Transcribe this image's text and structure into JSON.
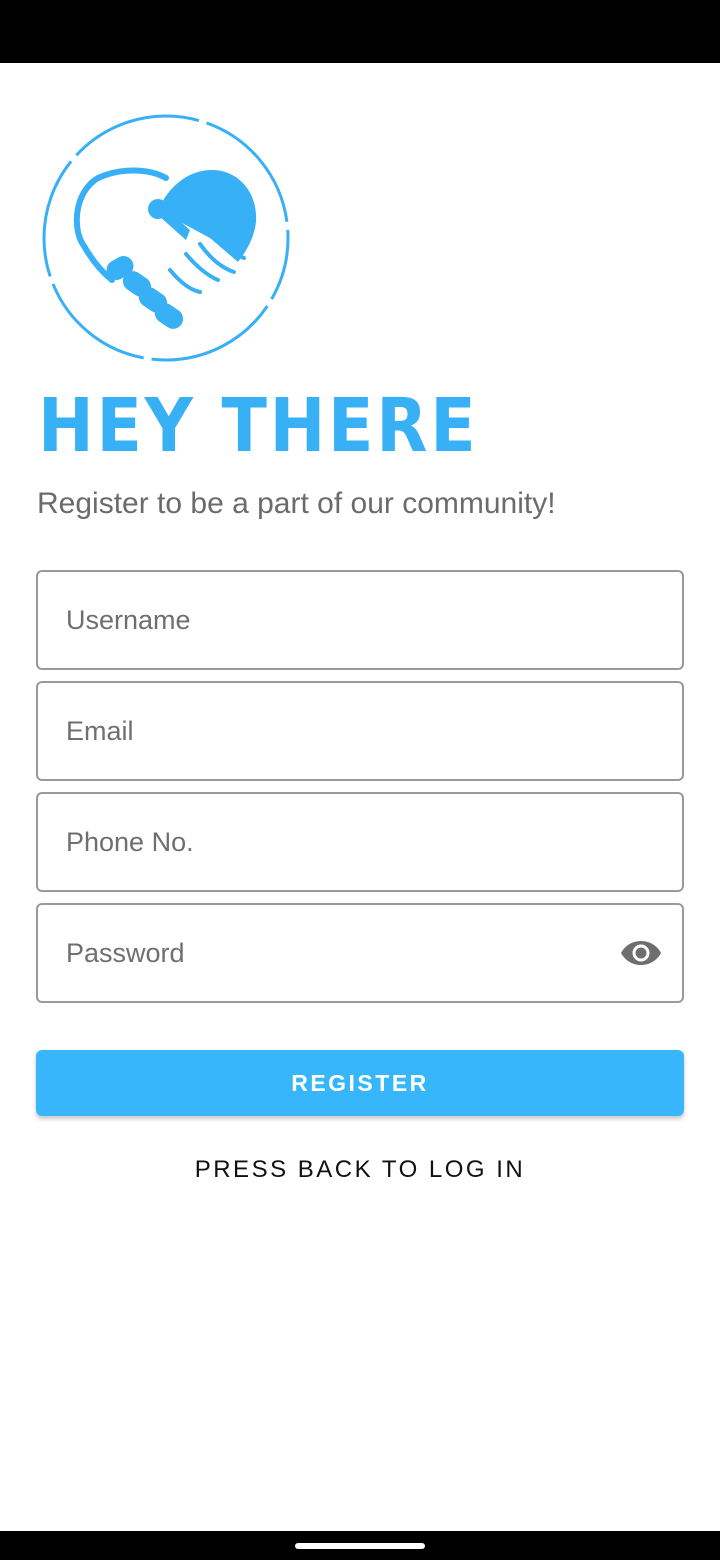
{
  "app": {
    "title": "HEY THERE",
    "subtitle": "Register to be a part of our community!",
    "logo_icon": "handshake-heart-icon"
  },
  "form": {
    "username_placeholder": "Username",
    "username_value": "",
    "email_placeholder": "Email",
    "email_value": "",
    "phone_placeholder": "Phone No.",
    "phone_value": "",
    "password_placeholder": "Password",
    "password_value": "",
    "password_toggle_icon": "eye-icon"
  },
  "actions": {
    "register_label": "REGISTER",
    "back_label": "PRESS BACK TO LOG IN"
  },
  "colors": {
    "accent": "#38b6fb",
    "text_secondary": "#6b6b6b",
    "border": "#9a9a9a"
  }
}
